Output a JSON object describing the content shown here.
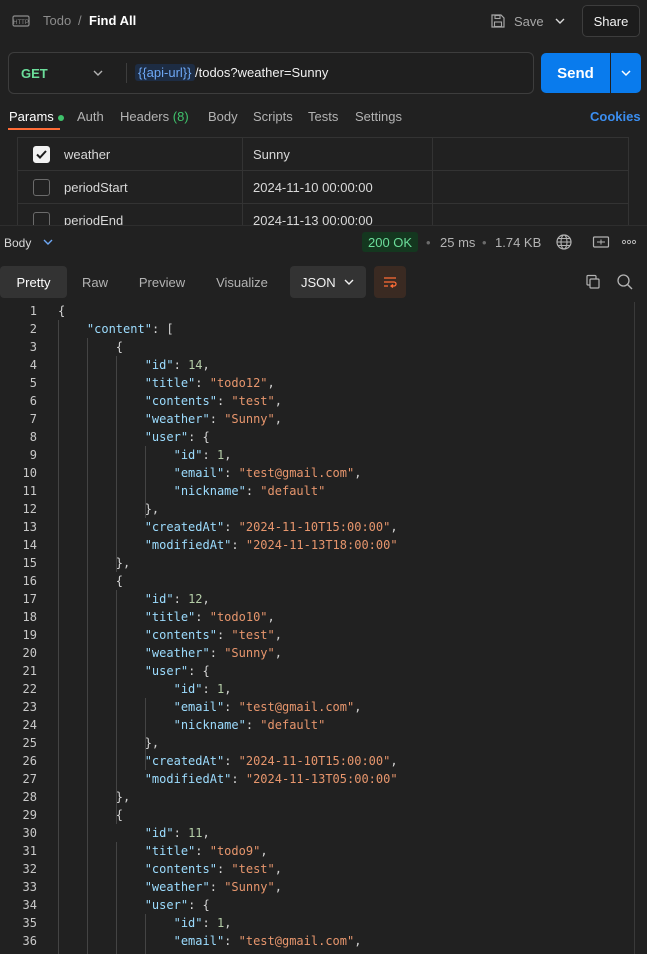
{
  "header": {
    "collection": "Todo",
    "separator": "/",
    "request_name": "Find All",
    "save_label": "Save",
    "share_label": "Share"
  },
  "request": {
    "method": "GET",
    "url_variable": "{{api-url}}",
    "url_path": "/todos?weather=Sunny",
    "send_label": "Send"
  },
  "request_tabs": {
    "params": "Params",
    "auth": "Auth",
    "headers": "Headers",
    "headers_count": "(8)",
    "body": "Body",
    "scripts": "Scripts",
    "tests": "Tests",
    "settings": "Settings",
    "cookies": "Cookies"
  },
  "params": [
    {
      "key": "weather",
      "value": "Sunny",
      "checked": true
    },
    {
      "key": "periodStart",
      "value": "2024-11-10 00:00:00",
      "checked": false
    },
    {
      "key": "periodEnd",
      "value": "2024-11-13 00:00:00",
      "checked": false
    }
  ],
  "response": {
    "body_label": "Body",
    "status": "200 OK",
    "time": "25 ms",
    "size": "1.74 KB"
  },
  "view_tabs": {
    "pretty": "Pretty",
    "raw": "Raw",
    "preview": "Preview",
    "visualize": "Visualize",
    "format": "JSON"
  },
  "colors": {
    "accent": "#ff6c37",
    "send": "#097bed",
    "status_ok": "#6bdd9a"
  },
  "code_lines": [
    [
      [
        "p",
        "{"
      ]
    ],
    [
      [
        "p",
        "    "
      ],
      [
        "k",
        "\"content\""
      ],
      [
        "p",
        ": ["
      ]
    ],
    [
      [
        "p",
        "        {"
      ]
    ],
    [
      [
        "p",
        "            "
      ],
      [
        "k",
        "\"id\""
      ],
      [
        "p",
        ": "
      ],
      [
        "n",
        "14"
      ],
      [
        "p",
        ","
      ]
    ],
    [
      [
        "p",
        "            "
      ],
      [
        "k",
        "\"title\""
      ],
      [
        "p",
        ": "
      ],
      [
        "s",
        "\"todo12\""
      ],
      [
        "p",
        ","
      ]
    ],
    [
      [
        "p",
        "            "
      ],
      [
        "k",
        "\"contents\""
      ],
      [
        "p",
        ": "
      ],
      [
        "s",
        "\"test\""
      ],
      [
        "p",
        ","
      ]
    ],
    [
      [
        "p",
        "            "
      ],
      [
        "k",
        "\"weather\""
      ],
      [
        "p",
        ": "
      ],
      [
        "s",
        "\"Sunny\""
      ],
      [
        "p",
        ","
      ]
    ],
    [
      [
        "p",
        "            "
      ],
      [
        "k",
        "\"user\""
      ],
      [
        "p",
        ": {"
      ]
    ],
    [
      [
        "p",
        "                "
      ],
      [
        "k",
        "\"id\""
      ],
      [
        "p",
        ": "
      ],
      [
        "n",
        "1"
      ],
      [
        "p",
        ","
      ]
    ],
    [
      [
        "p",
        "                "
      ],
      [
        "k",
        "\"email\""
      ],
      [
        "p",
        ": "
      ],
      [
        "s",
        "\"test@gmail.com\""
      ],
      [
        "p",
        ","
      ]
    ],
    [
      [
        "p",
        "                "
      ],
      [
        "k",
        "\"nickname\""
      ],
      [
        "p",
        ": "
      ],
      [
        "s",
        "\"default\""
      ]
    ],
    [
      [
        "p",
        "            },"
      ]
    ],
    [
      [
        "p",
        "            "
      ],
      [
        "k",
        "\"createdAt\""
      ],
      [
        "p",
        ": "
      ],
      [
        "s",
        "\"2024-11-10T15:00:00\""
      ],
      [
        "p",
        ","
      ]
    ],
    [
      [
        "p",
        "            "
      ],
      [
        "k",
        "\"modifiedAt\""
      ],
      [
        "p",
        ": "
      ],
      [
        "s",
        "\"2024-11-13T18:00:00\""
      ]
    ],
    [
      [
        "p",
        "        },"
      ]
    ],
    [
      [
        "p",
        "        {"
      ]
    ],
    [
      [
        "p",
        "            "
      ],
      [
        "k",
        "\"id\""
      ],
      [
        "p",
        ": "
      ],
      [
        "n",
        "12"
      ],
      [
        "p",
        ","
      ]
    ],
    [
      [
        "p",
        "            "
      ],
      [
        "k",
        "\"title\""
      ],
      [
        "p",
        ": "
      ],
      [
        "s",
        "\"todo10\""
      ],
      [
        "p",
        ","
      ]
    ],
    [
      [
        "p",
        "            "
      ],
      [
        "k",
        "\"contents\""
      ],
      [
        "p",
        ": "
      ],
      [
        "s",
        "\"test\""
      ],
      [
        "p",
        ","
      ]
    ],
    [
      [
        "p",
        "            "
      ],
      [
        "k",
        "\"weather\""
      ],
      [
        "p",
        ": "
      ],
      [
        "s",
        "\"Sunny\""
      ],
      [
        "p",
        ","
      ]
    ],
    [
      [
        "p",
        "            "
      ],
      [
        "k",
        "\"user\""
      ],
      [
        "p",
        ": {"
      ]
    ],
    [
      [
        "p",
        "                "
      ],
      [
        "k",
        "\"id\""
      ],
      [
        "p",
        ": "
      ],
      [
        "n",
        "1"
      ],
      [
        "p",
        ","
      ]
    ],
    [
      [
        "p",
        "                "
      ],
      [
        "k",
        "\"email\""
      ],
      [
        "p",
        ": "
      ],
      [
        "s",
        "\"test@gmail.com\""
      ],
      [
        "p",
        ","
      ]
    ],
    [
      [
        "p",
        "                "
      ],
      [
        "k",
        "\"nickname\""
      ],
      [
        "p",
        ": "
      ],
      [
        "s",
        "\"default\""
      ]
    ],
    [
      [
        "p",
        "            },"
      ]
    ],
    [
      [
        "p",
        "            "
      ],
      [
        "k",
        "\"createdAt\""
      ],
      [
        "p",
        ": "
      ],
      [
        "s",
        "\"2024-11-10T15:00:00\""
      ],
      [
        "p",
        ","
      ]
    ],
    [
      [
        "p",
        "            "
      ],
      [
        "k",
        "\"modifiedAt\""
      ],
      [
        "p",
        ": "
      ],
      [
        "s",
        "\"2024-11-13T05:00:00\""
      ]
    ],
    [
      [
        "p",
        "        },"
      ]
    ],
    [
      [
        "p",
        "        {"
      ]
    ],
    [
      [
        "p",
        "            "
      ],
      [
        "k",
        "\"id\""
      ],
      [
        "p",
        ": "
      ],
      [
        "n",
        "11"
      ],
      [
        "p",
        ","
      ]
    ],
    [
      [
        "p",
        "            "
      ],
      [
        "k",
        "\"title\""
      ],
      [
        "p",
        ": "
      ],
      [
        "s",
        "\"todo9\""
      ],
      [
        "p",
        ","
      ]
    ],
    [
      [
        "p",
        "            "
      ],
      [
        "k",
        "\"contents\""
      ],
      [
        "p",
        ": "
      ],
      [
        "s",
        "\"test\""
      ],
      [
        "p",
        ","
      ]
    ],
    [
      [
        "p",
        "            "
      ],
      [
        "k",
        "\"weather\""
      ],
      [
        "p",
        ": "
      ],
      [
        "s",
        "\"Sunny\""
      ],
      [
        "p",
        ","
      ]
    ],
    [
      [
        "p",
        "            "
      ],
      [
        "k",
        "\"user\""
      ],
      [
        "p",
        ": {"
      ]
    ],
    [
      [
        "p",
        "                "
      ],
      [
        "k",
        "\"id\""
      ],
      [
        "p",
        ": "
      ],
      [
        "n",
        "1"
      ],
      [
        "p",
        ","
      ]
    ],
    [
      [
        "p",
        "                "
      ],
      [
        "k",
        "\"email\""
      ],
      [
        "p",
        ": "
      ],
      [
        "s",
        "\"test@gmail.com\""
      ],
      [
        "p",
        ","
      ]
    ]
  ]
}
